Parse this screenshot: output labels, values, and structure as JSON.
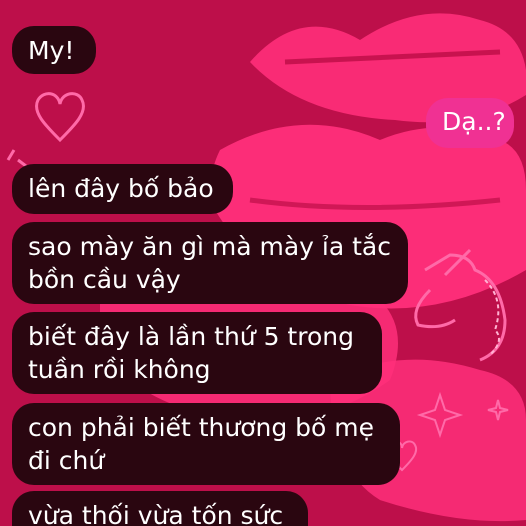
{
  "conversation": {
    "messages": [
      {
        "sender": "other",
        "text": "My!"
      },
      {
        "sender": "self",
        "text": "Dạ..?"
      },
      {
        "sender": "other",
        "text": "lên đây bố bảo"
      },
      {
        "sender": "other",
        "text": "sao mày ăn gì mà mày ỉa tắc\nbồn cầu vậy"
      },
      {
        "sender": "other",
        "text": "biết đây là lần thứ 5 trong\ntuần rồi không"
      },
      {
        "sender": "other",
        "text": "con phải biết thương bố mẹ\nđi chứ"
      },
      {
        "sender": "other",
        "text": "vừa thối vừa tốn sức"
      }
    ]
  },
  "wallpaper": {
    "theme": "lips-hearts-unicorn",
    "icons": [
      "lips-icon",
      "heart-icon",
      "unicorn-icon",
      "sparkle-icon"
    ]
  },
  "colors": {
    "background": "#c8124f",
    "lips": "#ff2f7a",
    "incoming_bubble": "#2a0610",
    "outgoing_bubble": "#f03193",
    "text": "#ffffff"
  }
}
